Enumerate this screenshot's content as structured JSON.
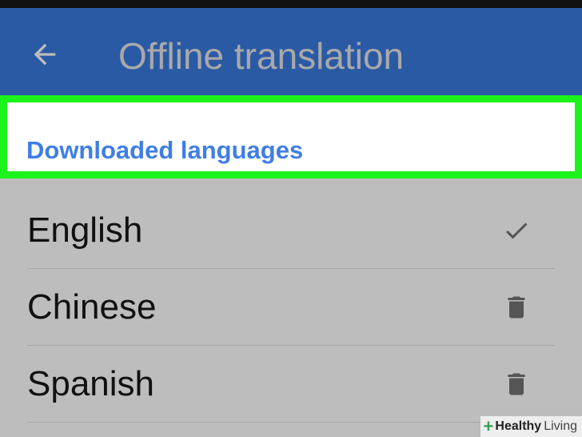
{
  "app_bar": {
    "title": "Offline translation",
    "back_icon": "arrow-left-icon"
  },
  "section": {
    "header": "Downloaded languages"
  },
  "languages": [
    {
      "name": "English",
      "icon": "checkmark-icon"
    },
    {
      "name": "Chinese",
      "icon": "trash-icon"
    },
    {
      "name": "Spanish",
      "icon": "trash-icon"
    }
  ],
  "watermark": {
    "part1": "Healthy",
    "part2": "Living"
  },
  "colors": {
    "app_bar": "#2b5aa5",
    "highlight_border": "#1cf21c",
    "section_header": "#3f7ee6",
    "list_background": "#bdbdbd",
    "icon": "#555555"
  }
}
